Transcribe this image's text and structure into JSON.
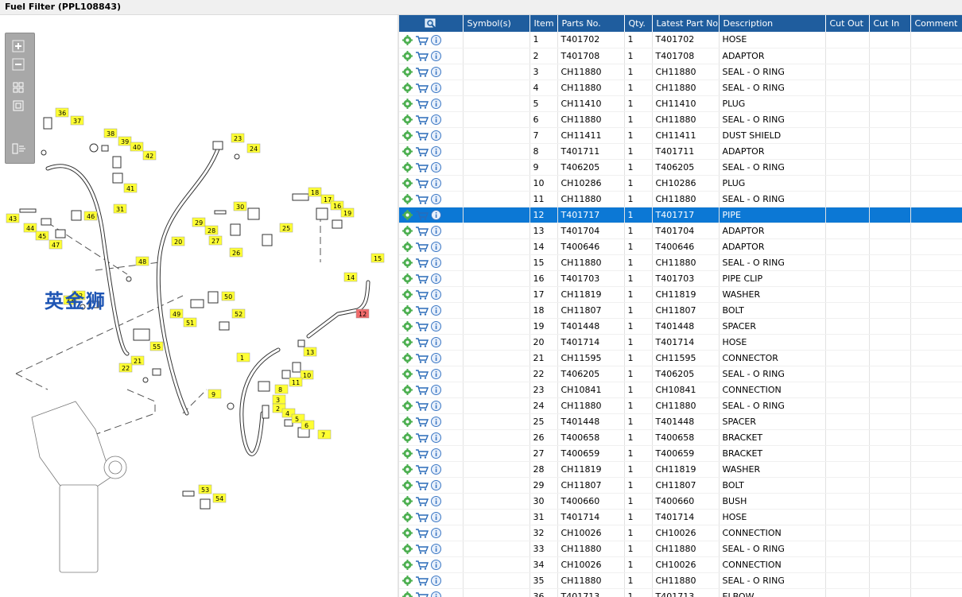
{
  "title": "Fuel Filter (PPL108843)",
  "watermark": "英金狮",
  "colors": {
    "header": "#1f5d9e",
    "selected_row": "#0c78d5",
    "callout": "#ffff33",
    "callout_selected": "#f26b6b"
  },
  "icons": [
    "gear-icon",
    "cart-icon",
    "info-icon"
  ],
  "columns": [
    "",
    "Symbol(s)",
    "Item",
    "Parts No.",
    "Qty.",
    "Latest Part No.",
    "Description",
    "Cut Out",
    "Cut In",
    "Comment"
  ],
  "selected_item": "12",
  "rows": [
    {
      "item": "1",
      "part": "T401702",
      "qty": "1",
      "latest": "T401702",
      "desc": "HOSE"
    },
    {
      "item": "2",
      "part": "T401708",
      "qty": "1",
      "latest": "T401708",
      "desc": "ADAPTOR"
    },
    {
      "item": "3",
      "part": "CH11880",
      "qty": "1",
      "latest": "CH11880",
      "desc": "SEAL - O RING"
    },
    {
      "item": "4",
      "part": "CH11880",
      "qty": "1",
      "latest": "CH11880",
      "desc": "SEAL - O RING"
    },
    {
      "item": "5",
      "part": "CH11410",
      "qty": "1",
      "latest": "CH11410",
      "desc": "PLUG"
    },
    {
      "item": "6",
      "part": "CH11880",
      "qty": "1",
      "latest": "CH11880",
      "desc": "SEAL - O RING"
    },
    {
      "item": "7",
      "part": "CH11411",
      "qty": "1",
      "latest": "CH11411",
      "desc": "DUST SHIELD"
    },
    {
      "item": "8",
      "part": "T401711",
      "qty": "1",
      "latest": "T401711",
      "desc": "ADAPTOR"
    },
    {
      "item": "9",
      "part": "T406205",
      "qty": "1",
      "latest": "T406205",
      "desc": "SEAL - O RING"
    },
    {
      "item": "10",
      "part": "CH10286",
      "qty": "1",
      "latest": "CH10286",
      "desc": "PLUG"
    },
    {
      "item": "11",
      "part": "CH11880",
      "qty": "1",
      "latest": "CH11880",
      "desc": "SEAL - O RING"
    },
    {
      "item": "12",
      "part": "T401717",
      "qty": "1",
      "latest": "T401717",
      "desc": "PIPE"
    },
    {
      "item": "13",
      "part": "T401704",
      "qty": "1",
      "latest": "T401704",
      "desc": "ADAPTOR"
    },
    {
      "item": "14",
      "part": "T400646",
      "qty": "1",
      "latest": "T400646",
      "desc": "ADAPTOR"
    },
    {
      "item": "15",
      "part": "CH11880",
      "qty": "1",
      "latest": "CH11880",
      "desc": "SEAL - O RING"
    },
    {
      "item": "16",
      "part": "T401703",
      "qty": "1",
      "latest": "T401703",
      "desc": "PIPE CLIP"
    },
    {
      "item": "17",
      "part": "CH11819",
      "qty": "1",
      "latest": "CH11819",
      "desc": "WASHER"
    },
    {
      "item": "18",
      "part": "CH11807",
      "qty": "1",
      "latest": "CH11807",
      "desc": "BOLT"
    },
    {
      "item": "19",
      "part": "T401448",
      "qty": "1",
      "latest": "T401448",
      "desc": "SPACER"
    },
    {
      "item": "20",
      "part": "T401714",
      "qty": "1",
      "latest": "T401714",
      "desc": "HOSE"
    },
    {
      "item": "21",
      "part": "CH11595",
      "qty": "1",
      "latest": "CH11595",
      "desc": "CONNECTOR"
    },
    {
      "item": "22",
      "part": "T406205",
      "qty": "1",
      "latest": "T406205",
      "desc": "SEAL - O RING"
    },
    {
      "item": "23",
      "part": "CH10841",
      "qty": "1",
      "latest": "CH10841",
      "desc": "CONNECTION"
    },
    {
      "item": "24",
      "part": "CH11880",
      "qty": "1",
      "latest": "CH11880",
      "desc": "SEAL - O RING"
    },
    {
      "item": "25",
      "part": "T401448",
      "qty": "1",
      "latest": "T401448",
      "desc": "SPACER"
    },
    {
      "item": "26",
      "part": "T400658",
      "qty": "1",
      "latest": "T400658",
      "desc": "BRACKET"
    },
    {
      "item": "27",
      "part": "T400659",
      "qty": "1",
      "latest": "T400659",
      "desc": "BRACKET"
    },
    {
      "item": "28",
      "part": "CH11819",
      "qty": "1",
      "latest": "CH11819",
      "desc": "WASHER"
    },
    {
      "item": "29",
      "part": "CH11807",
      "qty": "1",
      "latest": "CH11807",
      "desc": "BOLT"
    },
    {
      "item": "30",
      "part": "T400660",
      "qty": "1",
      "latest": "T400660",
      "desc": "BUSH"
    },
    {
      "item": "31",
      "part": "T401714",
      "qty": "1",
      "latest": "T401714",
      "desc": "HOSE"
    },
    {
      "item": "32",
      "part": "CH10026",
      "qty": "1",
      "latest": "CH10026",
      "desc": "CONNECTION"
    },
    {
      "item": "33",
      "part": "CH11880",
      "qty": "1",
      "latest": "CH11880",
      "desc": "SEAL - O RING"
    },
    {
      "item": "34",
      "part": "CH10026",
      "qty": "1",
      "latest": "CH10026",
      "desc": "CONNECTION"
    },
    {
      "item": "35",
      "part": "CH11880",
      "qty": "1",
      "latest": "CH11880",
      "desc": "SEAL - O RING"
    },
    {
      "item": "36",
      "part": "T401713",
      "qty": "1",
      "latest": "T401713",
      "desc": "ELBOW"
    }
  ]
}
